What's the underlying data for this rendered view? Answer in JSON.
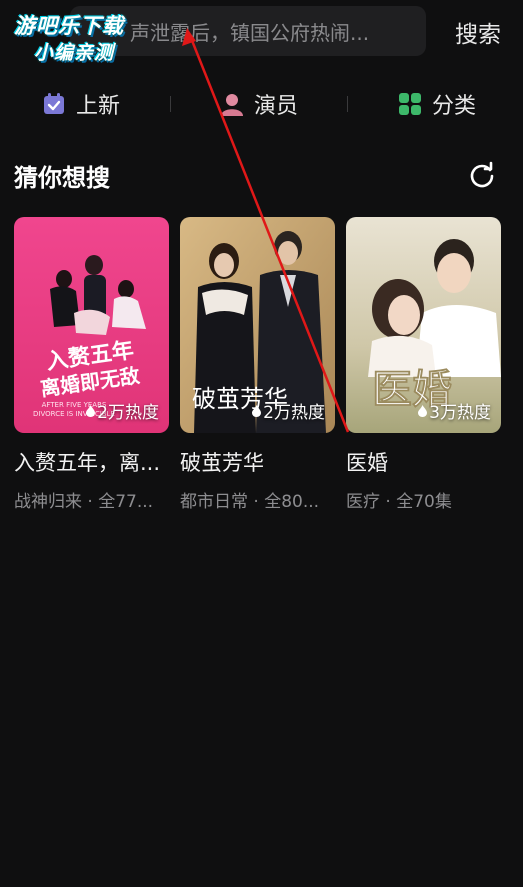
{
  "search": {
    "placeholder_text": "声泄露后，镇国公府热闹...",
    "button_label": "搜索"
  },
  "watermark": {
    "line1": "游吧乐下载",
    "line2": "小编亲测"
  },
  "nav": {
    "items": [
      {
        "label": "上新",
        "icon": "calendar-check-icon",
        "color": "#7b78d6"
      },
      {
        "label": "演员",
        "icon": "person-icon",
        "color": "#e08aa0"
      },
      {
        "label": "分类",
        "icon": "grid-icon",
        "color": "#3db86a"
      }
    ]
  },
  "section": {
    "title": "猜你想搜",
    "refresh_icon": "refresh-icon"
  },
  "cards": [
    {
      "title": "入赘五年，离...",
      "subtitle": "战神归来 · 全77...",
      "heat": "2万热度",
      "poster_text": "入赘五年离婚即无敌"
    },
    {
      "title": "破茧芳华",
      "subtitle": "都市日常 · 全80...",
      "heat": "2万热度",
      "poster_text": "破茧芳华"
    },
    {
      "title": "医婚",
      "subtitle": "医疗 · 全70集",
      "heat": "3万热度",
      "poster_text": "医婚"
    }
  ],
  "colors": {
    "background": "#0f0f10",
    "annotation": "#e01818"
  }
}
